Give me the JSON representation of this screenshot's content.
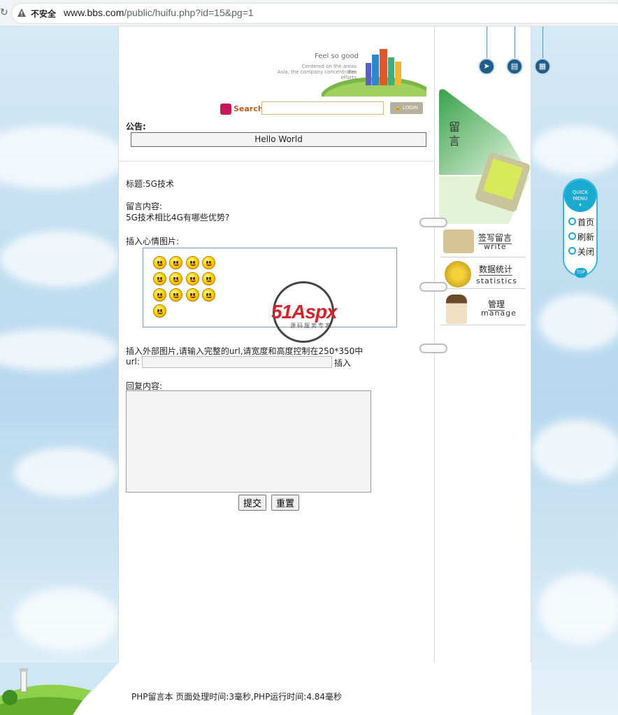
{
  "browser": {
    "security_label": "不安全",
    "url_host": "www.bbs.com",
    "url_path": "/public/huifu.php?id=15&pg=1"
  },
  "header": {
    "slogan": "Feel so good",
    "tagline_1": "Centered on the areas like",
    "tagline_2": "Asia, the company concentrates efforts",
    "search_label": "Search",
    "search_value": "",
    "login_label": "LOGIN"
  },
  "notice": {
    "label": "公告:",
    "text": "Hello World"
  },
  "post": {
    "title_label": "标题:",
    "title": "5G技术",
    "content_label": "留言内容:",
    "content": "5G技术相比4G有哪些优势?",
    "mood_label": "插入心情图片:",
    "external_label": "插入外部图片,请输入完整的url,请宽度和高度控制在250*350中",
    "url_label": "url:",
    "url_value": "",
    "insert_label": "插入",
    "reply_label": "回复内容:",
    "reply_value": "",
    "submit_label": "提交",
    "reset_label": "重置"
  },
  "watermark": {
    "brand": "51Aspx",
    "sub": "源码服务专家"
  },
  "sidebar": {
    "banner_text": "留言",
    "items": [
      {
        "zh": "签写留言",
        "en": "write"
      },
      {
        "zh": "数据统计",
        "en": "statistics"
      },
      {
        "zh": "管理",
        "en": "manage"
      }
    ]
  },
  "quick_menu": {
    "title_1": "QUICK",
    "title_2": "MENU",
    "items": [
      "首页",
      "刷新",
      "关闭"
    ],
    "top_label": "TOP"
  },
  "footer": {
    "text": "PHP留言本  页面处理时间:3毫秒,PHP运行时间:4.84毫秒"
  }
}
